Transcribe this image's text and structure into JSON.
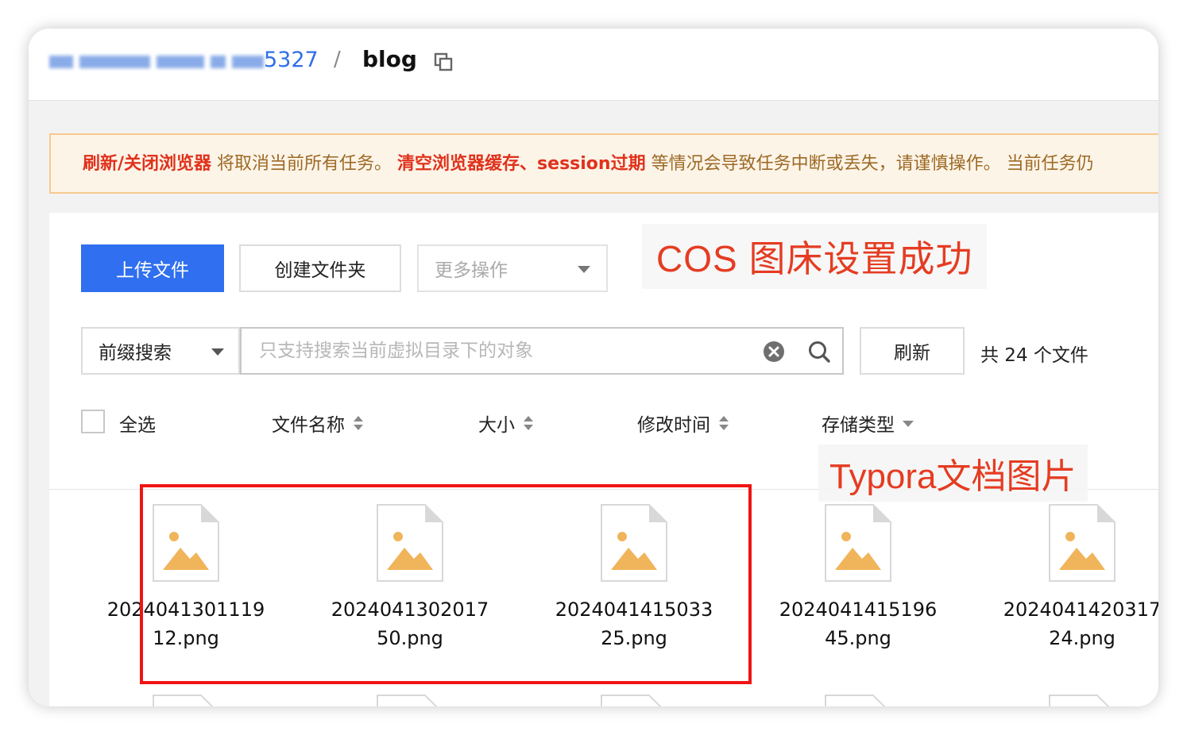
{
  "breadcrumb": {
    "bucket_suffix": "5327",
    "separator": "/",
    "current": "blog"
  },
  "notice": {
    "part1_strong": "刷新/关闭浏览器",
    "part2": " 将取消当前所有任务。 ",
    "part3_strong": "清空浏览器缓存、session过期",
    "part4": " 等情况会导致任务中断或丢失，请谨慎操作。 当前任务仍"
  },
  "toolbar": {
    "upload_label": "上传文件",
    "create_folder_label": "创建文件夹",
    "more_actions_label": "更多操作"
  },
  "search": {
    "prefix_label": "前缀搜索",
    "placeholder": "只支持搜索当前虚拟目录下的对象",
    "refresh_label": "刷新",
    "file_count": "共 24 个文件"
  },
  "table_header": {
    "select_all": "全选",
    "name": "文件名称",
    "size": "大小",
    "modified": "修改时间",
    "storage_type": "存储类型"
  },
  "annotations": {
    "title": "COS 图床设置成功",
    "subtitle": "Typora文档图片"
  },
  "files": [
    {
      "line1": "2024041301119",
      "line2": "12.png"
    },
    {
      "line1": "2024041302017",
      "line2": "50.png"
    },
    {
      "line1": "2024041415033",
      "line2": "25.png"
    },
    {
      "line1": "2024041415196",
      "line2": "45.png"
    },
    {
      "line1": "2024041420317",
      "line2": "24.png"
    }
  ],
  "colors": {
    "primary": "#2f6ff0",
    "link": "#2f6fe8",
    "warning_text": "#e0321c",
    "annotation_red": "#e53c22",
    "image_icon": "#f0b45a"
  }
}
